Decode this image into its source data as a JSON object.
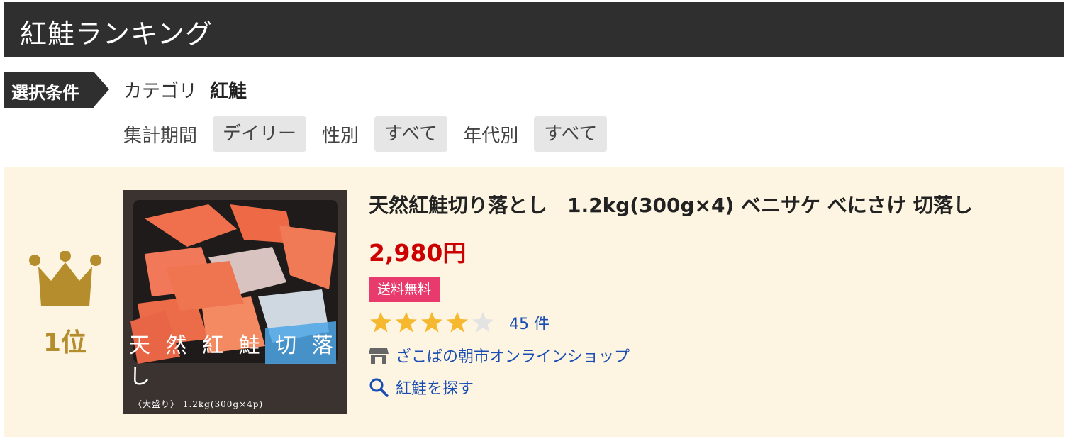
{
  "header": {
    "title": "紅鮭ランキング"
  },
  "conditions": {
    "tag": "選択条件",
    "category_label": "カテゴリ",
    "category_value": "紅鮭",
    "period_label": "集計期間",
    "period_value": "デイリー",
    "gender_label": "性別",
    "gender_value": "すべて",
    "age_label": "年代別",
    "age_value": "すべて"
  },
  "item": {
    "rank": "1位",
    "title": "天然紅鮭切り落とし　1.2kg(300g×4) ベニサケ べにさけ 切落し",
    "price": "2,980円",
    "badge": "送料無料",
    "rating": 4.5,
    "review_count": "45 件",
    "shop": "ざこばの朝市オンラインショップ",
    "search_link": "紅鮭を探す",
    "image_text": "天 然 紅 鮭 切 落 し",
    "image_subtext": "〈大盛り〉 1.2kg(300g×4p)"
  },
  "colors": {
    "header_bg": "#2f2f2f",
    "item_bg": "#fdf5e1",
    "price": "#cc0000",
    "badge": "#e83a6d",
    "link": "#1a4db3",
    "star": "#f5b82e",
    "crown": "#b58d2d"
  },
  "icons": [
    "crown-icon",
    "star-icon",
    "shop-icon",
    "search-icon"
  ]
}
